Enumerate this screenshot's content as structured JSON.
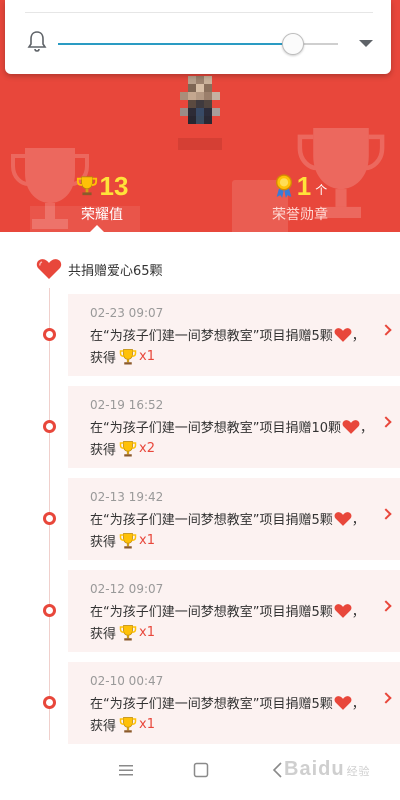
{
  "volume": {
    "level": 0.84,
    "icon": "bell-icon",
    "accent": "#2a9bc3"
  },
  "header": {
    "brand_color": "#e8473b",
    "stats": [
      {
        "value": "13",
        "unit": "",
        "label": "荣耀值",
        "icon": "trophy-icon"
      },
      {
        "value": "1",
        "unit": "个",
        "label": "荣誉勋章",
        "icon": "medal-icon"
      }
    ]
  },
  "summary": {
    "text": "共捐赠爱心65颗",
    "icon": "heart-icon"
  },
  "entries": [
    {
      "date": "02-23 09:07",
      "text": "在“为孩子们建一间梦想教室”项目捐赠5颗",
      "suffix": "，",
      "reward_label": "获得",
      "multiplier": "x1"
    },
    {
      "date": "02-19 16:52",
      "text": "在“为孩子们建一间梦想教室”项目捐赠10颗",
      "suffix": "，",
      "reward_label": "获得",
      "multiplier": "x2"
    },
    {
      "date": "02-13 19:42",
      "text": "在“为孩子们建一间梦想教室”项目捐赠5颗",
      "suffix": "，",
      "reward_label": "获得",
      "multiplier": "x1"
    },
    {
      "date": "02-12 09:07",
      "text": "在“为孩子们建一间梦想教室”项目捐赠5颗",
      "suffix": "，",
      "reward_label": "获得",
      "multiplier": "x1"
    },
    {
      "date": "02-10 00:47",
      "text": "在“为孩子们建一间梦想教室”项目捐赠5颗",
      "suffix": "，",
      "reward_label": "获得",
      "multiplier": "x1"
    }
  ],
  "nav": {
    "buttons": [
      "menu-icon",
      "home-square-icon",
      "back-icon"
    ]
  },
  "watermark": {
    "brand": "Baidu",
    "sub": "经验"
  }
}
